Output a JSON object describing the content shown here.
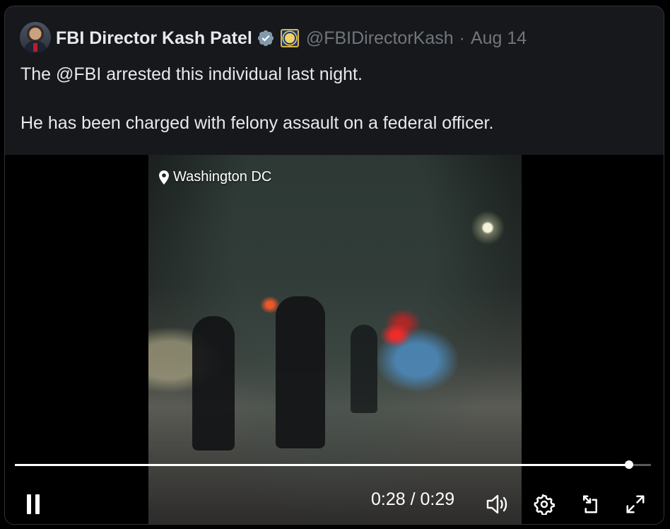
{
  "tweet": {
    "author_name": "FBI Director Kash Patel",
    "handle": "@FBIDirectorKash",
    "separator": "·",
    "date": "Aug 14",
    "text_line_1": "The @FBI arrested this individual last night.",
    "text_line_2": "He has been charged with felony assault on a federal officer."
  },
  "video": {
    "location": "Washington DC",
    "time_display": "0:28 / 0:29",
    "progress": 0.966,
    "state": "playing"
  },
  "colors": {
    "card_bg": "#16181c",
    "text_primary": "#e7e9ea",
    "text_secondary": "#71767b",
    "verified_badge": "#829aab",
    "video_progress": "#ffffff"
  },
  "icons": {
    "verified": "verified-badge-icon",
    "affiliate": "fbi-seal-icon",
    "location": "location-pin-icon",
    "pause": "pause-icon",
    "volume": "volume-icon",
    "settings": "settings-gear-icon",
    "pip": "picture-in-picture-icon",
    "fullscreen": "fullscreen-icon"
  }
}
